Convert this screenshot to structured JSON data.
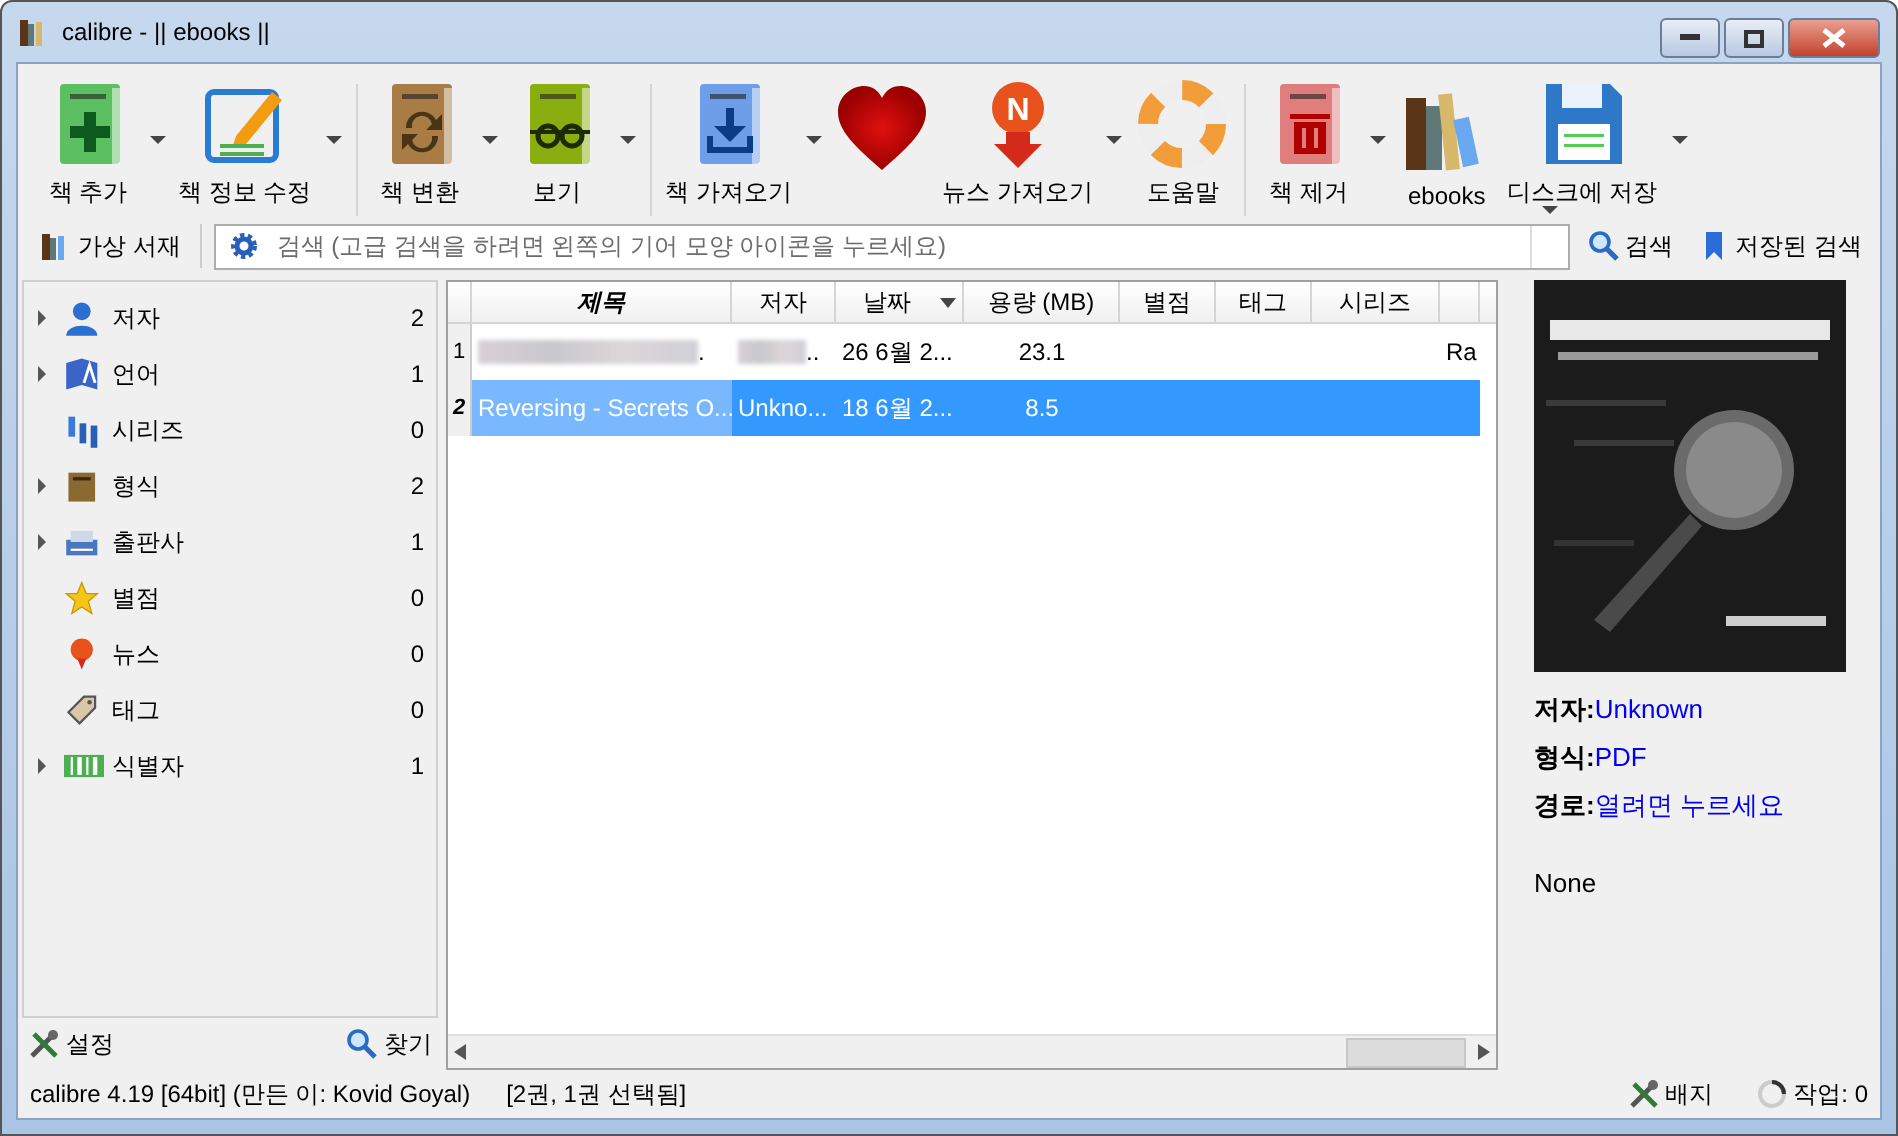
{
  "window": {
    "title": "calibre - || ebooks ||"
  },
  "toolbar": {
    "groups": [
      [
        {
          "label": "책 추가",
          "kind": "add",
          "has_menu": true
        },
        {
          "label": "책 정보 수정",
          "kind": "edit",
          "has_menu": true
        }
      ],
      [
        {
          "label": "책 변환",
          "kind": "convert",
          "has_menu": true
        },
        {
          "label": "보기",
          "kind": "view",
          "has_menu": true
        }
      ],
      [
        {
          "label": "책 가져오기",
          "kind": "fetch",
          "has_menu": true
        },
        {
          "kind": "heart",
          "has_menu": false
        },
        {
          "label": "뉴스 가져오기",
          "kind": "news",
          "badge": "N",
          "has_menu": true
        },
        {
          "label": "도움말",
          "kind": "help",
          "has_menu": false
        }
      ],
      [
        {
          "label": "책 제거",
          "kind": "remove",
          "has_menu": true
        },
        {
          "label": "ebooks",
          "kind": "library",
          "has_menu": false
        },
        {
          "label": "디스크에 저장",
          "kind": "save",
          "has_menu": true
        }
      ]
    ]
  },
  "search_bar": {
    "virtual_library": "가상 서재",
    "placeholder": "검색 (고급 검색을 하려면 왼쪽의 기어 모양 아이콘을 누르세요)",
    "search_button": "검색",
    "saved_searches": "저장된 검색"
  },
  "sidebar": {
    "items": [
      {
        "label": "저자",
        "kind": "person",
        "count": "2",
        "expandable": true
      },
      {
        "label": "언어",
        "kind": "language",
        "count": "1",
        "expandable": true
      },
      {
        "label": "시리즈",
        "kind": "series",
        "count": "0",
        "expandable": false
      },
      {
        "label": "형식",
        "kind": "format",
        "count": "2",
        "expandable": true
      },
      {
        "label": "출판사",
        "kind": "publisher",
        "count": "1",
        "expandable": true
      },
      {
        "label": "별점",
        "kind": "star",
        "count": "0",
        "expandable": false
      },
      {
        "label": "뉴스",
        "kind": "news",
        "count": "0",
        "expandable": false
      },
      {
        "label": "태그",
        "kind": "tag",
        "count": "0",
        "expandable": false
      },
      {
        "label": "식별자",
        "kind": "barcode",
        "count": "1",
        "expandable": true
      }
    ],
    "settings_button": "설정",
    "find_button": "찾기"
  },
  "table": {
    "columns": [
      {
        "label": "제목",
        "sorted": false,
        "bold": true
      },
      {
        "label": "저자",
        "sorted": false,
        "bold": false
      },
      {
        "label": "날짜",
        "sorted": true,
        "bold": false
      },
      {
        "label": "용량 (MB)",
        "sorted": false,
        "bold": false
      },
      {
        "label": "별점",
        "sorted": false,
        "bold": false
      },
      {
        "label": "태그",
        "sorted": false,
        "bold": false
      },
      {
        "label": "시리즈",
        "sorted": false,
        "bold": false
      }
    ],
    "rows": [
      {
        "number": "1",
        "selected": false,
        "blurred": true,
        "cells": [
          ".",
          "..",
          "26 6월 2...",
          "23.1",
          "",
          "",
          "",
          "Ra"
        ]
      },
      {
        "number": "2",
        "selected": true,
        "blurred": false,
        "cells": [
          "Reversing - Secrets O...",
          "Unkno...",
          "18 6월 2...",
          "8.5",
          "",
          "",
          "",
          ""
        ]
      }
    ]
  },
  "details": {
    "fields": [
      {
        "label": "저자:",
        "value": "Unknown"
      },
      {
        "label": "형식:",
        "value": "PDF"
      },
      {
        "label": "경로:",
        "value": "열려면 누르세요"
      }
    ],
    "comments": "None"
  },
  "status_bar": {
    "version": "calibre 4.19 [64bit] (만든 이: Kovid Goyal)",
    "selection": "[2권, 1권 선택됨]",
    "badge": "배지",
    "jobs": "작업: 0"
  }
}
